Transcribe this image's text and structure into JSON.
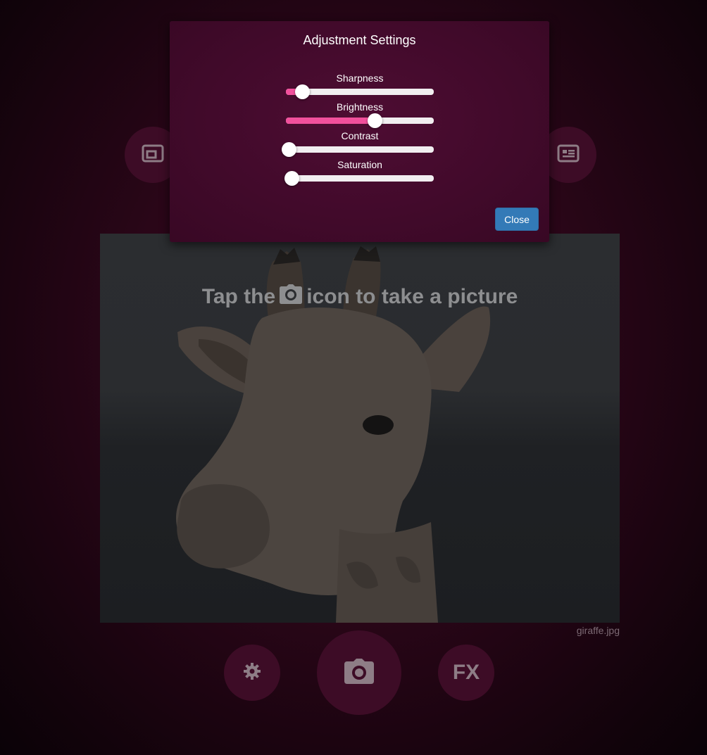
{
  "toolbar": {
    "left_icon": "picture-in-picture-icon",
    "right_icon": "article-list-icon"
  },
  "modal": {
    "title": "Adjustment Settings",
    "sliders": [
      {
        "label": "Sharpness",
        "value": 0.11
      },
      {
        "label": "Brightness",
        "value": 0.6
      },
      {
        "label": "Contrast",
        "value": 0.02
      },
      {
        "label": "Saturation",
        "value": 0.04
      }
    ],
    "close_label": "Close",
    "colors": {
      "fill": "#f1509c",
      "close_button": "#337ab7"
    }
  },
  "viewer": {
    "hint_before": "Tap the",
    "hint_after": "icon to take a picture",
    "hint_icon": "camera-icon",
    "filename": "giraffe.jpg"
  },
  "controls": {
    "settings_icon": "gear-icon",
    "camera_icon": "camera-icon",
    "fx_label": "FX"
  }
}
